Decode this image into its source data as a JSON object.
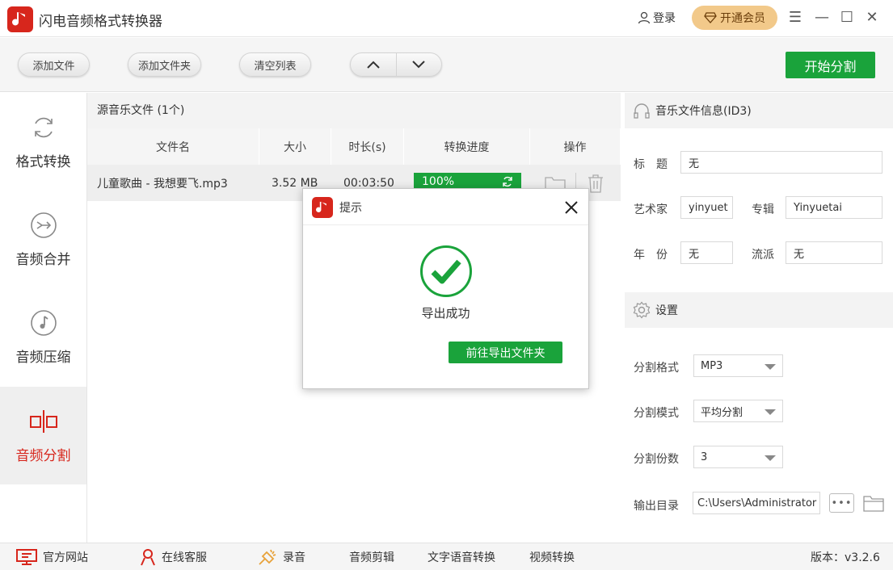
{
  "app": {
    "title": "闪电音频格式转换器"
  },
  "header": {
    "login": "登录",
    "vip": "开通会员",
    "controls": {
      "menu": "☰",
      "minimize": "—",
      "maximize": "☐",
      "close": "✕"
    }
  },
  "toolbar": {
    "add_file": "添加文件",
    "add_folder": "添加文件夹",
    "clear_list": "清空列表",
    "start": "开始分割"
  },
  "sidebar": {
    "items": [
      {
        "label": "格式转换",
        "icon": "refresh-icon"
      },
      {
        "label": "音频合并",
        "icon": "merge-icon"
      },
      {
        "label": "音频压缩",
        "icon": "music-note-icon"
      },
      {
        "label": "音频分割",
        "icon": "split-icon",
        "active": true
      }
    ]
  },
  "file_list": {
    "title": "源音乐文件 (1个)",
    "columns": [
      "文件名",
      "大小",
      "时长(s)",
      "转换进度",
      "操作"
    ],
    "rows": [
      {
        "name": "儿童歌曲 - 我想要飞.mp3",
        "size": "3.52 MB",
        "duration": "00:03:50",
        "progress": "100%"
      }
    ]
  },
  "id3": {
    "section_title": "音乐文件信息(ID3)",
    "title_label": "标　题",
    "title_value": "无",
    "artist_label": "艺术家",
    "artist_value": "yinyuet",
    "album_label": "专辑",
    "album_value": "Yinyuetai",
    "year_label": "年　份",
    "year_value": "无",
    "genre_label": "流派",
    "genre_value": "无"
  },
  "settings": {
    "section_title": "设置",
    "format_label": "分割格式",
    "format_value": "MP3",
    "mode_label": "分割模式",
    "mode_value": "平均分割",
    "count_label": "分割份数",
    "count_value": "3",
    "output_label": "输出目录",
    "output_value": "C:\\Users\\Administrator",
    "browse": "•••"
  },
  "bottom": {
    "website": "官方网站",
    "service": "在线客服",
    "record": "录音",
    "audio_edit": "音频剪辑",
    "tts": "文字语音转换",
    "video_convert": "视频转换",
    "version": "版本：v3.2.6"
  },
  "dialog": {
    "title": "提示",
    "message": "导出成功",
    "button": "前往导出文件夹"
  },
  "colors": {
    "brand_red": "#d7261c",
    "accent_green": "#1aa33b",
    "vip_gold": "#f2c98a"
  }
}
